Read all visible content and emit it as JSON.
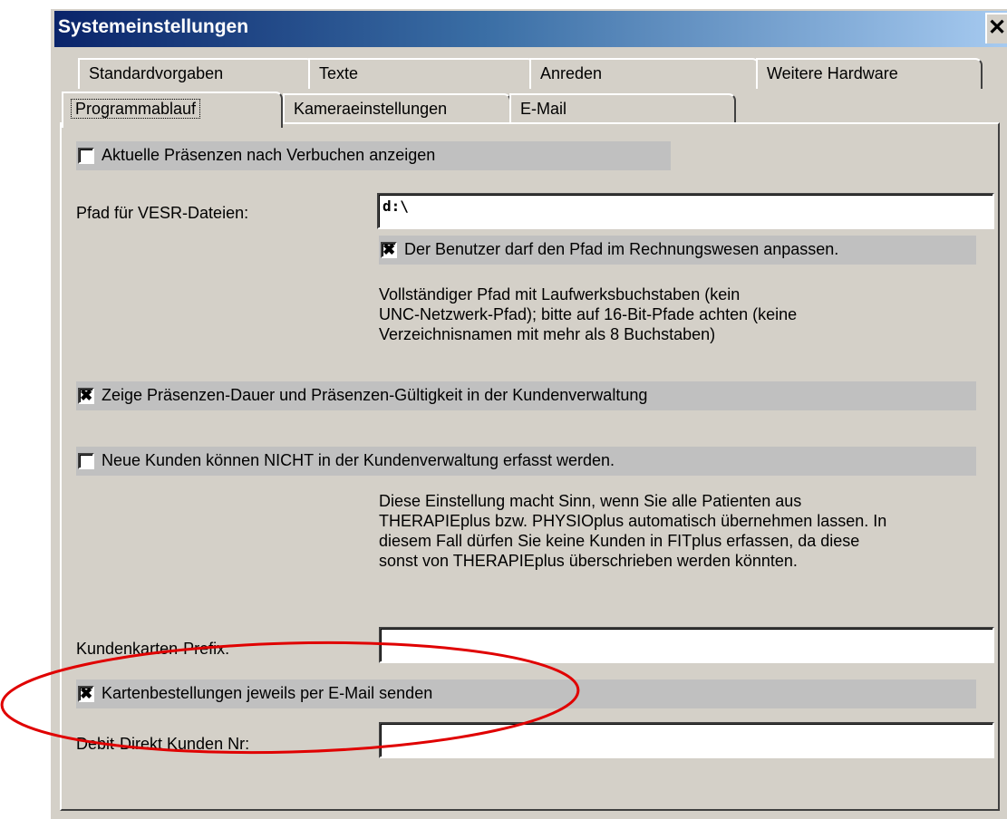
{
  "window": {
    "title": "Systemeinstellungen",
    "close_glyph": "✕"
  },
  "tabs": {
    "row1": [
      "Standardvorgaben",
      "Texte",
      "Anreden",
      "Weitere Hardware"
    ],
    "row2": [
      "Programmablauf",
      "Kameraeinstellungen",
      "E-Mail"
    ],
    "active": "Programmablauf"
  },
  "options": {
    "show_presences": {
      "label": "Aktuelle Präsenzen nach Verbuchen anzeigen",
      "checked": false
    },
    "vesr_path_label": "Pfad für VESR-Dateien:",
    "vesr_path_value": "d:\\",
    "user_may_adjust": {
      "label": "Der Benutzer darf den Pfad im Rechnungswesen anpassen.",
      "checked": true
    },
    "vesr_hint": [
      "Vollständiger Pfad mit Laufwerksbuchstaben (kein",
      "UNC-Netzwerk-Pfad); bitte auf 16-Bit-Pfade achten (keine",
      "Verzeichnisnamen mit mehr als 8 Buchstaben)"
    ],
    "show_duration": {
      "label": "Zeige Präsenzen-Dauer und Präsenzen-Gültigkeit in der Kundenverwaltung",
      "checked": true
    },
    "no_new_customers": {
      "label": "Neue Kunden können NICHT in der Kundenverwaltung erfasst werden.",
      "checked": false
    },
    "customers_hint": [
      "Diese Einstellung macht Sinn, wenn Sie alle Patienten aus",
      "THERAPIEplus bzw. PHYSIOplus automatisch übernehmen lassen. In",
      "diesem Fall dürfen Sie keine Kunden in FITplus erfassen, da diese",
      "sonst von THERAPIEplus überschrieben werden könnten."
    ],
    "card_prefix_label": "Kundenkarten-Prefix:",
    "card_prefix_value": "",
    "card_orders_email": {
      "label": "Kartenbestellungen jeweils per E-Mail senden",
      "checked": true
    },
    "debit_direct_label": "Debit-Direkt Kunden Nr:",
    "debit_direct_value": ""
  },
  "check_glyph": "✖",
  "annotation_color": "#e00000"
}
